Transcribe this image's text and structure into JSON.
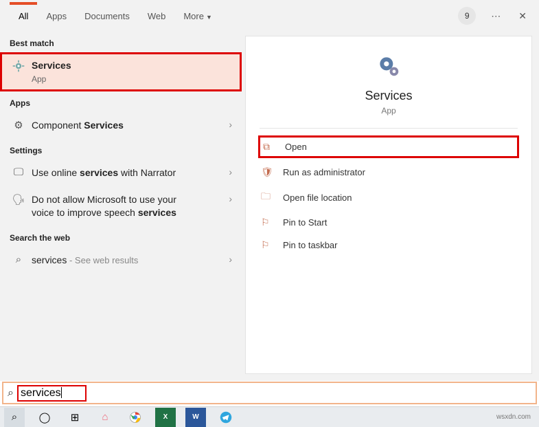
{
  "tabs": {
    "all": "All",
    "apps": "Apps",
    "documents": "Documents",
    "web": "Web",
    "more": "More"
  },
  "badge": "9",
  "sections": {
    "best_match": "Best match",
    "apps": "Apps",
    "settings": "Settings",
    "web": "Search the web"
  },
  "best": {
    "title": "Services",
    "sub": "App"
  },
  "app1_pre": "Component ",
  "app1_bold": "Services",
  "s1_pre": "Use online ",
  "s1_bold": "services",
  "s1_post": " with Narrator",
  "s2_line1": "Do not allow Microsoft to use your",
  "s2_line2a": "voice to improve speech ",
  "s2_line2b": "services",
  "web1_pre": "services",
  "web1_post": " - See web results",
  "detail": {
    "title": "Services",
    "sub": "App"
  },
  "actions": {
    "open": "Open",
    "run_admin": "Run as administrator",
    "file_loc": "Open file location",
    "pin_start": "Pin to Start",
    "pin_task": "Pin to taskbar"
  },
  "search_value": "services",
  "source": "wsxdn.com"
}
